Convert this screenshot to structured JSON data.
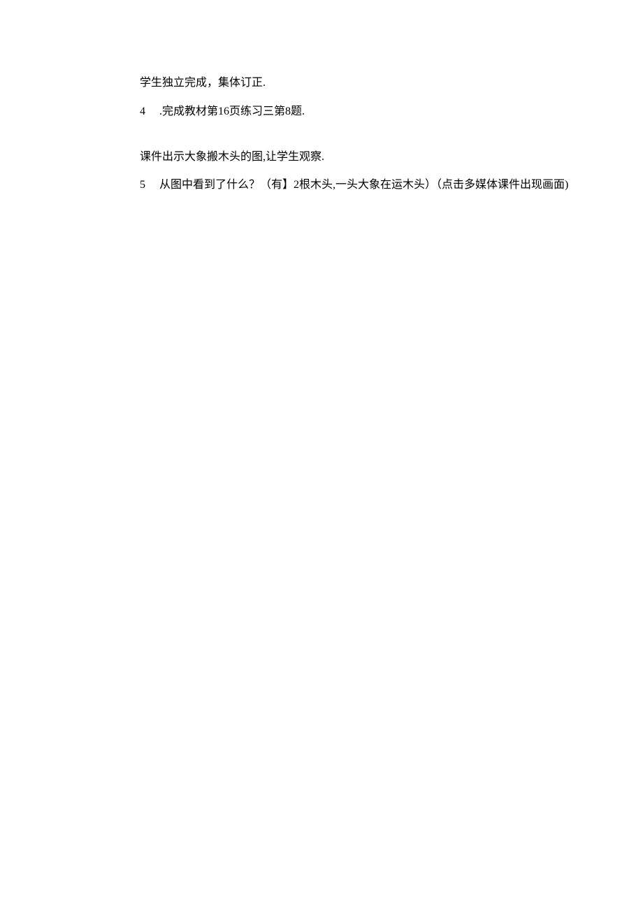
{
  "lines": {
    "l1": "学生独立完成，集体订正.",
    "l2_num": "4",
    "l2_text": ".完成教材第16页练习三第8题.",
    "l3": "课件出示大象搬木头的图,让学生观察.",
    "l4_num": "5",
    "l4_text": "从图中看到了什么？（有】2根木头,一头大象在运木头）（点击多媒体课件出现画面)"
  }
}
